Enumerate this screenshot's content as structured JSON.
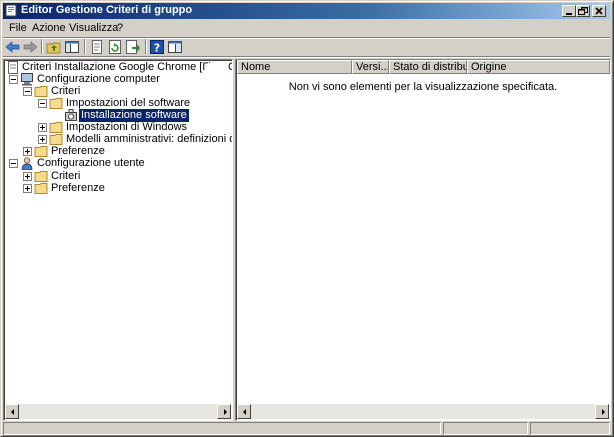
{
  "window": {
    "title": "Editor Gestione Criteri di gruppo",
    "caption_buttons": [
      "minimize",
      "restore",
      "close"
    ]
  },
  "menu": [
    "File",
    "Azione",
    "Visualizza",
    "?"
  ],
  "toolbar": {
    "buttons": [
      "back-arrow-icon",
      "forward-arrow-icon",
      "up-folder-icon",
      "show-hide-tree-icon",
      "properties-icon",
      "refresh-icon",
      "export-list-icon",
      "help-icon",
      "show-hide-action-pane-icon"
    ]
  },
  "tree": {
    "root": "Criteri Installazione Google Chrome [Γ˙",
    "root_trailing": "C",
    "computer_config": "Configurazione computer",
    "criteri": "Criteri",
    "impostazioni_software": "Impostazioni del software",
    "installazione_software": "Installazione software",
    "impostazioni_windows": "Impostazioni di Windows",
    "modelli_amministrativi": "Modelli amministrativi: definizioni di criteri (file",
    "preferenze": "Preferenze",
    "user_config": "Configurazione utente",
    "user_criteri": "Criteri",
    "user_preferenze": "Preferenze"
  },
  "list": {
    "columns": [
      "Nome",
      "Versi...",
      "Stato di distribu...",
      "Origine"
    ],
    "empty_message": "Non vi sono elementi per la visualizzazione specificata."
  },
  "colors": {
    "titlebar_start": "#0a246a",
    "titlebar_end": "#a6caf0",
    "selection": "#0a246a",
    "face": "#d4d0c8"
  }
}
